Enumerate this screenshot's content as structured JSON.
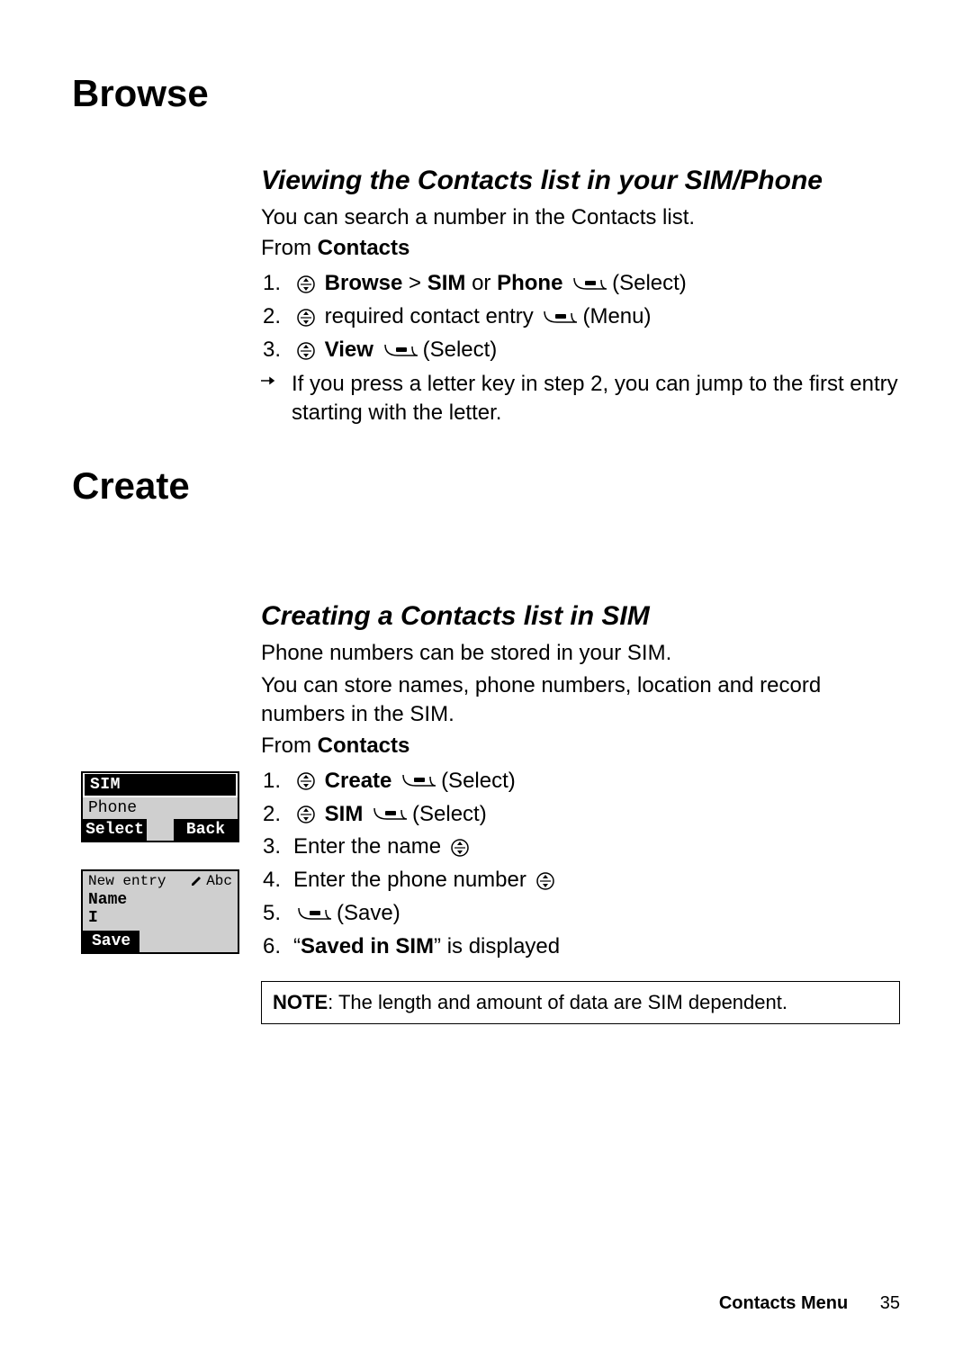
{
  "section1": {
    "title": "Browse",
    "sub": {
      "heading": "Viewing the Contacts list in your SIM/Phone",
      "intro": "You can search a number in the Contacts list.",
      "from_prefix": "From ",
      "from_bold": "Contacts",
      "steps": [
        {
          "num": "1.",
          "parts": [
            "",
            "nav",
            " ",
            "b:Browse",
            " > ",
            "b:SIM",
            " or ",
            "b:Phone",
            " ",
            "soft",
            "(Select)"
          ]
        },
        {
          "num": "2.",
          "parts": [
            "",
            "nav",
            " required contact entry ",
            "soft",
            "(Menu)"
          ]
        },
        {
          "num": "3.",
          "parts": [
            "",
            "nav",
            " ",
            "b:View",
            " ",
            "soft",
            "(Select)"
          ]
        }
      ],
      "tip": "If you press a letter key in step 2, you can jump to the first entry starting with the letter."
    }
  },
  "section2": {
    "title": "Create",
    "sub": {
      "heading": "Creating a Contacts list in SIM",
      "intro1": "Phone numbers can be stored in your SIM.",
      "intro2": "You can store names, phone numbers, location and record numbers in the SIM.",
      "from_prefix": "From ",
      "from_bold": "Contacts",
      "steps": [
        {
          "num": "1.",
          "parts": [
            "",
            "nav",
            " ",
            "b:Create",
            " ",
            "soft",
            "(Select)"
          ]
        },
        {
          "num": "2.",
          "parts": [
            "",
            "nav",
            " ",
            "b:SIM",
            " ",
            "soft",
            "(Select)"
          ]
        },
        {
          "num": "3.",
          "parts": [
            "Enter the name ",
            "nav"
          ]
        },
        {
          "num": "4.",
          "parts": [
            "Enter the phone number ",
            "nav"
          ]
        },
        {
          "num": "5.",
          "parts": [
            "",
            "soft",
            "(Save)"
          ]
        },
        {
          "num": "6.",
          "parts": [
            "“",
            "b:Saved in SIM",
            "” is displayed"
          ]
        }
      ],
      "note_label": "NOTE",
      "note_text": ": The length and amount of data are SIM dependent."
    }
  },
  "screens": {
    "s1": {
      "row1": "SIM",
      "row2": "Phone",
      "sk_left": "Select",
      "sk_right": "Back"
    },
    "s2": {
      "title": "New entry",
      "mode": "Abc",
      "label": "Name",
      "cursor": "I",
      "sk_left": "Save"
    }
  },
  "footer": {
    "label": "Contacts Menu",
    "page": "35"
  }
}
